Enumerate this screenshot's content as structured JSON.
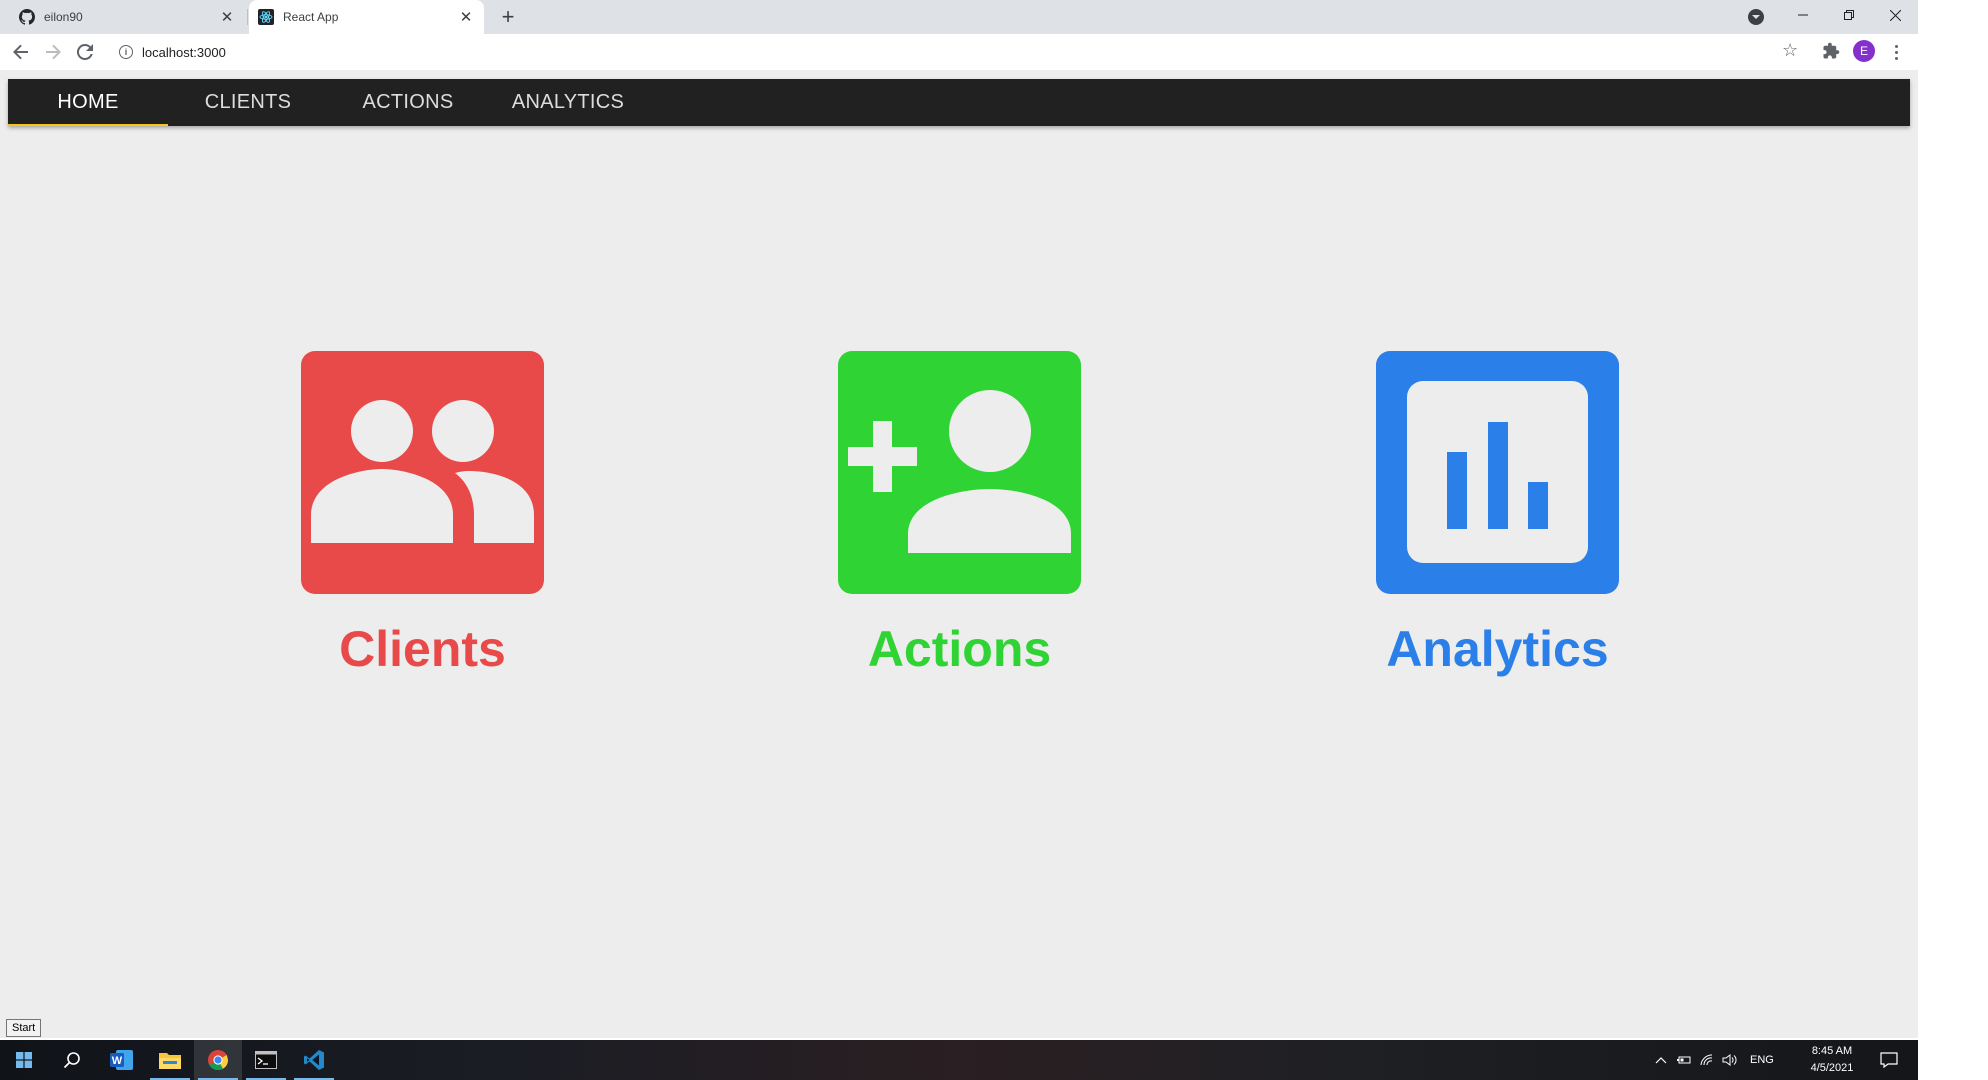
{
  "browser": {
    "tabs": [
      {
        "title": "eilon90",
        "favicon": "github-icon",
        "active": false
      },
      {
        "title": "React App",
        "favicon": "react-icon",
        "active": true
      }
    ],
    "new_tab_symbol": "+",
    "url": "localhost:3000",
    "profile_initial": "E",
    "profile_color": "#8430ce"
  },
  "app": {
    "nav": {
      "tabs": [
        {
          "label": "HOME",
          "active": true
        },
        {
          "label": "CLIENTS",
          "active": false
        },
        {
          "label": "ACTIONS",
          "active": false
        },
        {
          "label": "ANALYTICS",
          "active": false
        }
      ],
      "background": "#212121",
      "indicator_color": "#f5c518"
    },
    "cards": [
      {
        "label": "Clients",
        "icon": "people-icon",
        "color": "#e84a4a"
      },
      {
        "label": "Actions",
        "icon": "person-add-icon",
        "color": "#2fd434"
      },
      {
        "label": "Analytics",
        "icon": "analytics-icon",
        "color": "#2a7fe8"
      }
    ],
    "background": "#ededed"
  },
  "taskbar": {
    "start_tooltip": "Start",
    "apps": [
      "windows-start-icon",
      "search-icon",
      "word-icon",
      "file-explorer-icon",
      "chrome-icon",
      "terminal-icon",
      "vscode-icon"
    ],
    "language": "ENG",
    "time": "8:45 AM",
    "date": "4/5/2021"
  }
}
